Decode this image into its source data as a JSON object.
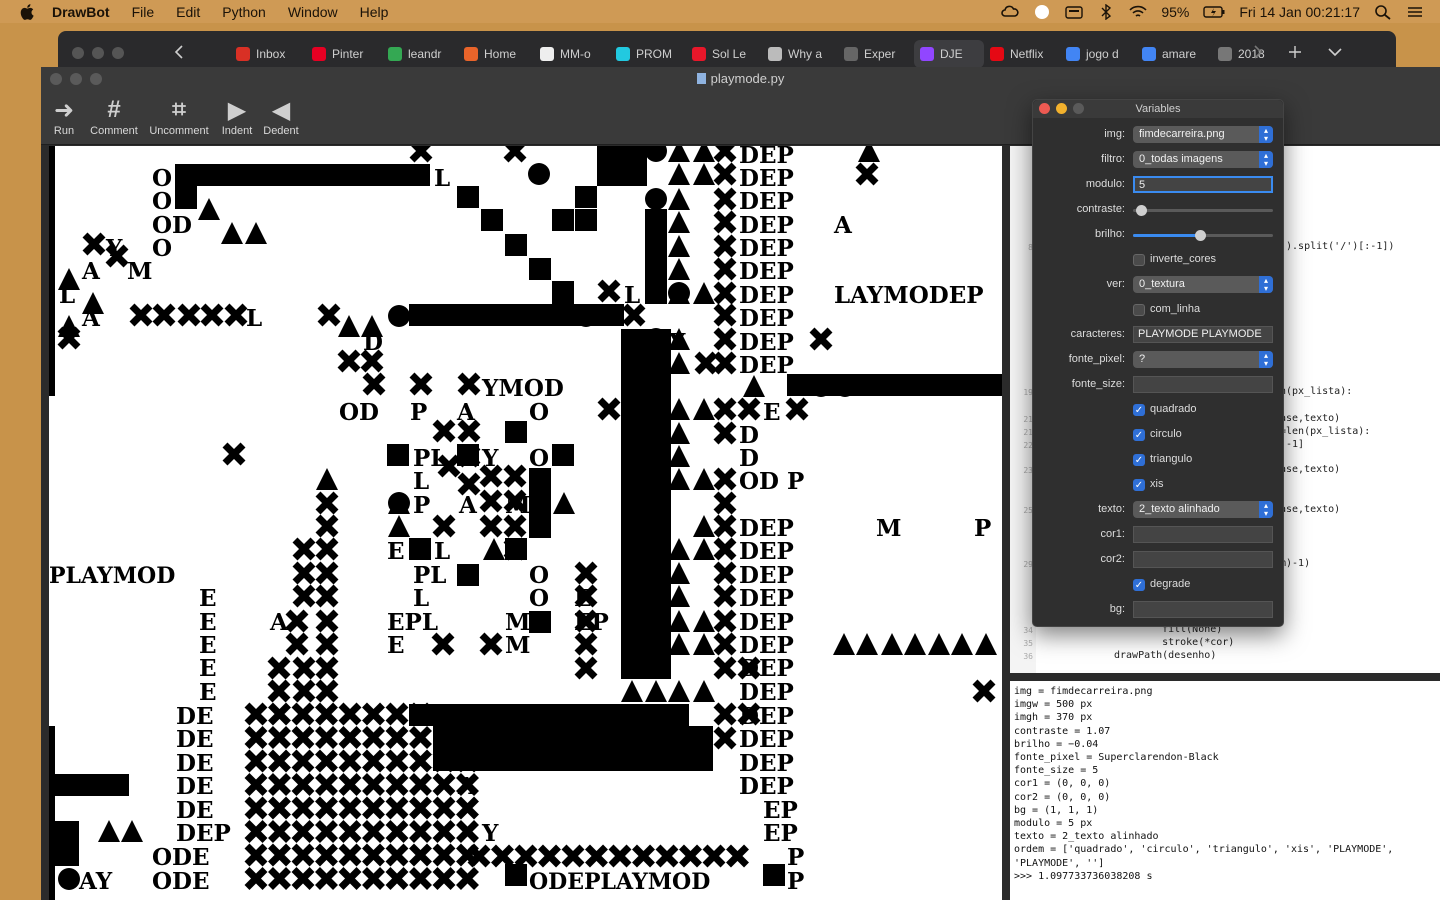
{
  "menubar": {
    "app": "DrawBot",
    "items": [
      "File",
      "Edit",
      "Python",
      "Window",
      "Help"
    ],
    "battery": "95%",
    "datetime": "Fri 14 Jan  00:21:17"
  },
  "browser": {
    "tabs": [
      {
        "label": "Inbox",
        "color": "#d93025"
      },
      {
        "label": "Pinter",
        "color": "#e60023"
      },
      {
        "label": "leandr",
        "color": "#34a853"
      },
      {
        "label": "Home",
        "color": "#e9642a"
      },
      {
        "label": "MM-o",
        "color": "#eeeeee"
      },
      {
        "label": "PROM",
        "color": "#22c9e0"
      },
      {
        "label": "Sol Le",
        "color": "#e8172a"
      },
      {
        "label": "Why a",
        "color": "#bbbbbb"
      },
      {
        "label": "Exper",
        "color": "#666666"
      },
      {
        "label": "DJE",
        "color": "#9146ff",
        "active": true
      },
      {
        "label": "Netflix",
        "color": "#e50914"
      },
      {
        "label": "jogo d",
        "color": "#4285f4"
      },
      {
        "label": "amare",
        "color": "#4285f4"
      },
      {
        "label": "2018",
        "color": "#777777"
      }
    ]
  },
  "window": {
    "title": "playmode.py",
    "toolbar": [
      {
        "label": "Run",
        "glyph": "➜"
      },
      {
        "label": "Comment",
        "glyph": "#"
      },
      {
        "label": "Uncomment",
        "glyph": "⌗"
      },
      {
        "label": "Indent",
        "glyph": "▶"
      },
      {
        "label": "Dedent",
        "glyph": "◀"
      }
    ]
  },
  "variables_panel": {
    "title": "Variables",
    "img": "fimdecarreira.png",
    "filtro": "0_todas imagens",
    "modulo": "5",
    "contraste_label": "contraste:",
    "contraste_level": 0.06,
    "brilho_label": "brilho:",
    "brilho_level": 0.48,
    "inverte_cores": "inverte_cores",
    "ver": "0_textura",
    "com_linha": "com_linha",
    "caracteres": "PLAYMODE PLAYMODE",
    "fonte_pixel": "?",
    "fonte_size": "",
    "quadrado": "quadrado",
    "circulo": "circulo",
    "triangulo": "triangulo",
    "xis": "xis",
    "texto": "2_texto alinhado",
    "cor1": "",
    "cor2": "",
    "degrade": "degrade",
    "bg": "",
    "labels": {
      "img": "img:",
      "filtro": "filtro:",
      "modulo": "modulo:",
      "ver": "ver:",
      "caracteres": "caracteres:",
      "fonte_pixel": "fonte_pixel:",
      "fonte_size": "fonte_size:",
      "texto": "texto:",
      "cor1": "cor1:",
      "cor2": "cor2:",
      "bg": "bg:"
    }
  },
  "code_lines": [
    {
      "n": "8",
      "text": ")).split('/')[:-1])"
    },
    {
      "n": "19",
      "text": "n(px_lista):"
    },
    {
      "n": "21",
      "text": "ase,texto)"
    },
    {
      "n": "21",
      "text": "=len(px_lista):"
    },
    {
      "n": "22",
      "text": ":-1]"
    },
    {
      "n": "23",
      "text": "ase,texto)"
    },
    {
      "n": "25",
      "text": "ase,texto)"
    },
    {
      "n": "29",
      "text": "m)-1)"
    },
    {
      "n": "34",
      "text": "    fill(None)"
    },
    {
      "n": "35",
      "text": "    stroke(*cor)"
    },
    {
      "n": "36",
      "text": "drawPath(desenho)"
    }
  ],
  "output_lines": [
    "img = fimdecarreira.png",
    "imgw = 500 px",
    "imgh = 370 px",
    "contraste = 1.07",
    "brilho = −0.04",
    "fonte_pixel = Superclarendon-Black",
    "fonte_size = 5",
    "cor1 = (0, 0, 0)",
    "cor2 = (0, 0, 0)",
    "bg = (1, 1, 1)",
    "modulo = 5 px",
    "texto = 2_texto alinhado",
    "ordem = ['quadrado', 'circulo', 'triangulo', 'xis', 'PLAYMODE',",
    "'PLAYMODE', '']",
    "",
    ">>> 1.097733736038208 s"
  ],
  "canvas_text": {
    "phrase": "LAYMODEP",
    "row_playmod": "PLAYMOD",
    "row_odeplaymod": "ODEPLAYMOD",
    "row_ymod": "YMOD",
    "word_dep": "DEP",
    "word_ode": "ODE",
    "word_de": "DE"
  }
}
